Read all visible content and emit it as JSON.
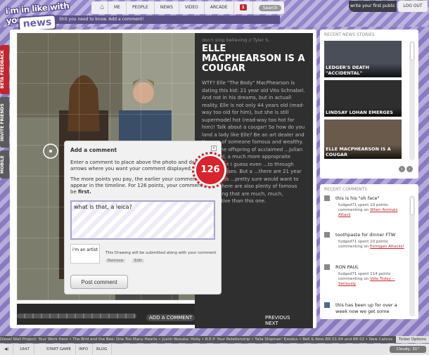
{
  "logo": {
    "line1": "i'm in like with you.",
    "line2": "news"
  },
  "tagline": "Shit you need to know. Add a comment!",
  "nav": {
    "items": [
      "ME",
      "PEOPLE",
      "NEWS",
      "VIDEO",
      "ARCADE"
    ],
    "badge": "1",
    "search": "Search"
  },
  "top_right": {
    "write": "write your first public",
    "logout": "LOG OUT"
  },
  "side_tabs": [
    "BETA FEEDBACK",
    "INVITE FRIENDS",
    "MOBILE"
  ],
  "article": {
    "kicker": "don't stop believing // Tyler S.",
    "title": "ELLE MACPHEARSON IS A COUGAR",
    "body": "WTF? Elle \"The Body\" MacPhearson is dating this kid: 21 year old Vito Schnabel. And not in his dreams, but in actuall reality. Elle is not only 44 years old (read-way too old for him), but she is still supermodel hot (read-way too hot for him)! Talk about a cougar! So how do you land a lady like Elle? Be an art dealer and the son of someone famous and wealthy. Vito is the offspring of acclaimed ...Julian Schnabel, a much more appropraite match. But I guess even ...to through mid-life crises. But a ...there are 21 year old models ...pretty sure would want to take ...There are also plenty of famous ...offspring that are much, much, ...attractive than this one.",
    "prev": "PREVIOUS",
    "next": "NEXT",
    "add_comment": "ADD A COMMENT"
  },
  "dialog": {
    "title": "Add a comment",
    "close": "x",
    "instructions": "Enter a comment to place above the photo and drag the arrows where you want your comment displayed.",
    "points_note_a": "The more points you pay, the earlier your comment will appear in the timeline. For 126 points, your comment can be ",
    "points_note_b": "first.",
    "points": "126",
    "comment_value": "what is that, a leica?",
    "drawing_thumb": "i'm an artist",
    "drawing_note": "This Drawing will be submitted along with your comment",
    "remove": "Remove",
    "edit": "Edit",
    "post": "Post comment"
  },
  "news": {
    "header": "RECENT NEWS STORIES",
    "stories": [
      "LEDGER'S DEATH \"ACCIDENTAL\"",
      "LINDSAY LOHAN EMERGES",
      "ELLE MACPHEARSON IS A COUGAR"
    ]
  },
  "comments": {
    "header": "RECENT COMMENTS",
    "items": [
      {
        "text": "this is his \"oh face\"",
        "user": "fudged71",
        "points": "10",
        "meta_mid": "spent 10 points commenting on",
        "link": "When Animals Attack"
      },
      {
        "text": "toothpaste for dinner FTW",
        "user": "fudged71",
        "points": "10",
        "meta_mid": "spent 10 points commenting on",
        "link": "Estrogen Attacks!"
      },
      {
        "text": "RON PAUL",
        "user": "fudged71",
        "points": "114",
        "meta_mid": "spent 114 points commenting on",
        "link": "Vote Today -- Seriously"
      },
      {
        "text": "this has been up for over a week now we get some",
        "user": "",
        "points": "",
        "meta_mid": "",
        "link": ""
      }
    ]
  },
  "ticker": {
    "text": "Diesel Wall Project: Your Work Here • The Bird and the Bee: One Too Many Hearts • Justin Nozuka: Holly • R.E.P. Your Relationship • Talla Shipmen' Exodus • Bell & Ross BR 01-94 and BR 02 • New Calicos",
    "label": "Ticker Options"
  },
  "bottom": {
    "points": "1647",
    "start": "START GAME",
    "info": "INFO",
    "blog": "BLOG",
    "weather": "Cloudy, 31°"
  }
}
